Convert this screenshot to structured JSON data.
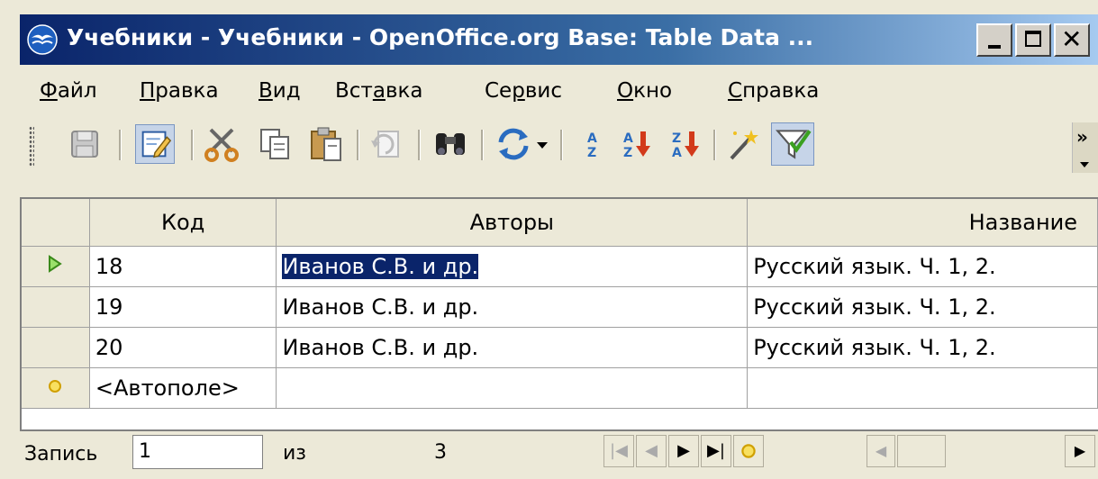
{
  "window": {
    "title": "Учебники - Учебники - OpenOffice.org Base: Table Data ...",
    "icon": "openoffice-gull-icon"
  },
  "menu": [
    {
      "label": "Файл",
      "accel_index": 0
    },
    {
      "label": "Правка",
      "accel_index": 0
    },
    {
      "label": "Вид",
      "accel_index": 0
    },
    {
      "label": "Вставка",
      "accel_index": 3
    },
    {
      "label": "Сервис",
      "accel_index": 2
    },
    {
      "label": "Окно",
      "accel_index": 0
    },
    {
      "label": "Справка",
      "accel_index": 0
    }
  ],
  "toolbar": {
    "icons": [
      "save-icon",
      "edit-data-icon",
      "cut-icon",
      "copy-icon",
      "paste-icon",
      "undo-icon",
      "find-icon",
      "refresh-icon",
      "sort-icon",
      "sort-ascending-icon",
      "sort-descending-icon",
      "autofilter-icon",
      "apply-filter-icon"
    ],
    "overflow": "»"
  },
  "table": {
    "columns": [
      "Код",
      "Авторы",
      "Название"
    ],
    "rows": [
      {
        "marker": "current",
        "cells": [
          "18",
          "Иванов С.В. и др.",
          "Русский язык. Ч. 1, 2."
        ]
      },
      {
        "marker": "",
        "cells": [
          "19",
          "Иванов С.В. и др.",
          "Русский язык. Ч. 1, 2."
        ]
      },
      {
        "marker": "",
        "cells": [
          "20",
          "Иванов С.В. и др.",
          "Русский язык. Ч. 1, 2."
        ]
      },
      {
        "marker": "new",
        "cells": [
          "<Автополе>",
          "",
          ""
        ]
      }
    ],
    "selection_color": "#0a246a"
  },
  "navigator": {
    "record_label": "Запись",
    "record_value": "1",
    "of_label": "из",
    "total": "3"
  },
  "colors": {
    "titlebar_start": "#0a246a",
    "titlebar_end": "#a6caf0",
    "face": "#ece9d8"
  }
}
